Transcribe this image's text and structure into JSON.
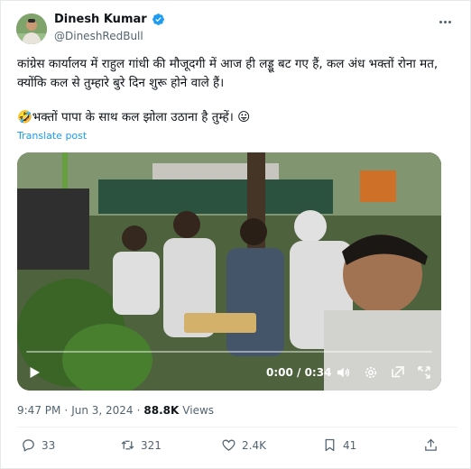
{
  "author": {
    "name": "Dinesh Kumar",
    "handle": "@DineshRedBull"
  },
  "tweet": {
    "text_line1": "कांग्रेस कार्यालय में राहुल गांधी की मौजूदगी में आज ही लड्डू बट गए हैं, कल अंध भक्तों रोना मत, क्योंकि कल से तुम्हारे बुरे दिन शुरू होने वाले हैं।",
    "text_line2": "🤣भक्तों पापा के साथ कल झोला उठाना है तुम्हें। 😛",
    "translate_label": "Translate post"
  },
  "video": {
    "time_label": "0:00 / 0:34",
    "progress": 0
  },
  "meta": {
    "time": "9:47 PM",
    "separator": "·",
    "date": "Jun 3, 2024",
    "views_count": "88.8K",
    "views_label": "Views"
  },
  "actions": {
    "replies": "33",
    "reposts": "321",
    "likes": "2.4K",
    "bookmarks": "41"
  },
  "colors": {
    "accent": "#1d9bf0",
    "text": "#0f1419",
    "muted": "#536471"
  }
}
